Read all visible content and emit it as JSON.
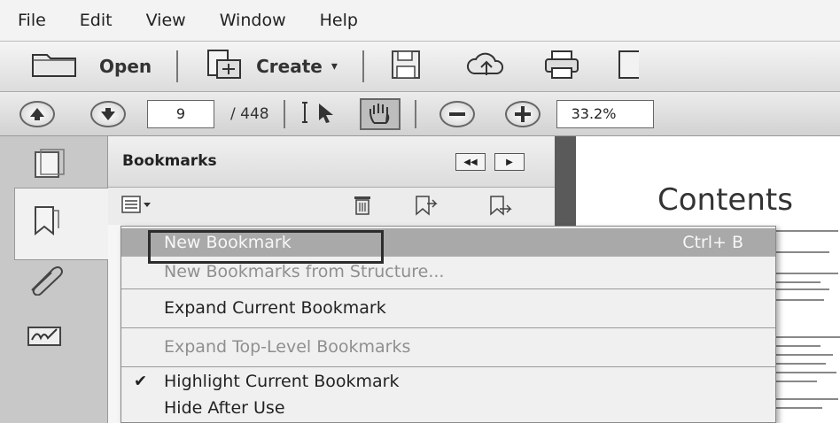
{
  "menubar": {
    "items": [
      "File",
      "Edit",
      "View",
      "Window",
      "Help"
    ]
  },
  "toolbar": {
    "open_label": "Open",
    "create_label": "Create",
    "page_current": "9",
    "page_total": "/ 448",
    "zoom": "33.2%"
  },
  "bookmarks_panel": {
    "title": "Bookmarks"
  },
  "document": {
    "heading": "Contents"
  },
  "context_menu": {
    "items": [
      {
        "label": "New Bookmark",
        "shortcut": "Ctrl+ B",
        "state": "highlighted-disabled"
      },
      {
        "label": "New Bookmarks from Structure...",
        "state": "disabled"
      },
      {
        "label": "Expand Current Bookmark",
        "state": "enabled"
      },
      {
        "label": "Expand Top-Level Bookmarks",
        "state": "disabled"
      },
      {
        "label": "Highlight Current Bookmark",
        "state": "checked"
      },
      {
        "label": "Hide After Use",
        "state": "enabled"
      }
    ]
  },
  "icons": {
    "open": "folder-icon",
    "create": "create-pdf-icon",
    "save": "floppy-disk-icon",
    "upload": "cloud-upload-icon",
    "print": "printer-icon",
    "page_up": "arrow-up-icon",
    "page_down": "arrow-down-icon",
    "select": "select-cursor-icon",
    "hand": "hand-icon",
    "zoom_out": "minus-icon",
    "zoom_in": "plus-icon"
  }
}
